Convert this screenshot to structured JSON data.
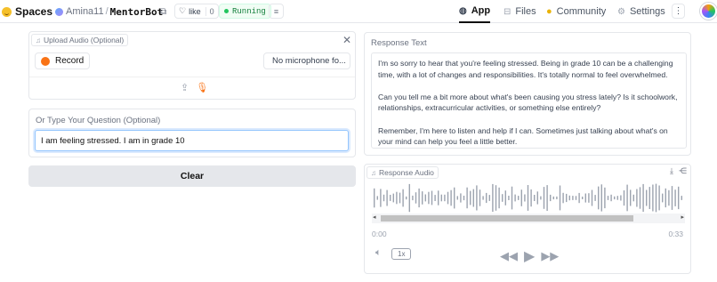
{
  "topbar": {
    "brand": "Spaces",
    "owner": "Amina11",
    "separator": "/",
    "repo": "MentorBot",
    "like_label": "like",
    "like_count": "0",
    "status": "Running",
    "tabs": [
      {
        "label": "App",
        "icon": "app-icon",
        "active": true
      },
      {
        "label": "Files",
        "icon": "files-icon",
        "active": false
      },
      {
        "label": "Community",
        "icon": "community-icon",
        "active": false
      },
      {
        "label": "Settings",
        "icon": "settings-icon",
        "active": false
      }
    ]
  },
  "upload": {
    "label": "Upload Audio (Optional)",
    "record_label": "Record",
    "mic_select": "No microphone fo..."
  },
  "question": {
    "label": "Or Type Your Question (Optional)",
    "value": "I am feeling stressed. I am in grade 10"
  },
  "clear_label": "Clear",
  "response": {
    "label": "Response Text",
    "paragraphs": [
      "I'm so sorry to hear that you're feeling stressed. Being in grade 10 can be a challenging time, with a lot of changes and responsibilities. It's totally normal to feel overwhelmed.",
      "Can you tell me a bit more about what's been causing you stress lately? Is it schoolwork, relationships, extracurricular activities, or something else entirely?",
      "Remember, I'm here to listen and help if I can. Sometimes just talking about what's on your mind can help you feel a little better."
    ]
  },
  "audio": {
    "label": "Response Audio",
    "time_start": "0:00",
    "time_end": "0:33",
    "speed": "1x"
  },
  "colors": {
    "accent_orange": "#f97316",
    "running_green": "#22c55e",
    "input_focus": "#93c5fd"
  }
}
